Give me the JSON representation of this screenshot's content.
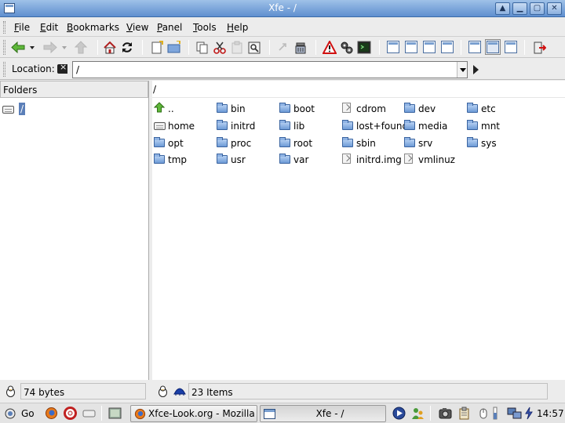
{
  "window": {
    "title": "Xfe - /"
  },
  "menu": {
    "items": [
      {
        "label": "File",
        "mnemonic": "F",
        "rest": "ile"
      },
      {
        "label": "Edit",
        "mnemonic": "E",
        "rest": "dit"
      },
      {
        "label": "Bookmarks",
        "mnemonic": "B",
        "rest": "ookmarks"
      },
      {
        "label": "View",
        "mnemonic": "V",
        "rest": "iew"
      },
      {
        "label": "Panel",
        "mnemonic": "P",
        "rest": "anel"
      },
      {
        "label": "Tools",
        "mnemonic": "T",
        "rest": "ools"
      },
      {
        "label": "Help",
        "mnemonic": "H",
        "rest": "elp"
      }
    ]
  },
  "location": {
    "label": "Location:",
    "value": "/"
  },
  "left_panel": {
    "header": "Folders",
    "tree_root": "/"
  },
  "right_panel": {
    "path": "/",
    "files": [
      {
        "name": "..",
        "icon": "up-arrow-icon"
      },
      {
        "name": "bin",
        "icon": "folder-icon"
      },
      {
        "name": "boot",
        "icon": "folder-icon"
      },
      {
        "name": "cdrom",
        "icon": "file-icon"
      },
      {
        "name": "dev",
        "icon": "folder-icon"
      },
      {
        "name": "etc",
        "icon": "folder-icon"
      },
      {
        "name": "home",
        "icon": "drive-icon"
      },
      {
        "name": "initrd",
        "icon": "folder-icon"
      },
      {
        "name": "lib",
        "icon": "folder-icon"
      },
      {
        "name": "lost+found",
        "icon": "folder-icon"
      },
      {
        "name": "media",
        "icon": "folder-icon"
      },
      {
        "name": "mnt",
        "icon": "folder-icon"
      },
      {
        "name": "opt",
        "icon": "folder-icon"
      },
      {
        "name": "proc",
        "icon": "folder-icon"
      },
      {
        "name": "root",
        "icon": "folder-icon"
      },
      {
        "name": "sbin",
        "icon": "folder-icon"
      },
      {
        "name": "srv",
        "icon": "folder-icon"
      },
      {
        "name": "sys",
        "icon": "folder-icon"
      },
      {
        "name": "tmp",
        "icon": "folder-icon"
      },
      {
        "name": "usr",
        "icon": "folder-icon"
      },
      {
        "name": "var",
        "icon": "folder-icon"
      },
      {
        "name": "initrd.img",
        "icon": "file-icon"
      },
      {
        "name": "vmlinuz",
        "icon": "file-icon"
      }
    ]
  },
  "status": {
    "left": "74 bytes",
    "right": "23 Items"
  },
  "taskbar": {
    "go_label": "Go",
    "tasks": [
      {
        "label": "Xfce-Look.org - Mozilla ..."
      },
      {
        "label": "Xfe - /"
      }
    ],
    "clock": "14:57"
  },
  "colors": {
    "selection": "#5b7fb8",
    "titlebar": "#6f9bd6",
    "folder": "#7fa6dc"
  }
}
